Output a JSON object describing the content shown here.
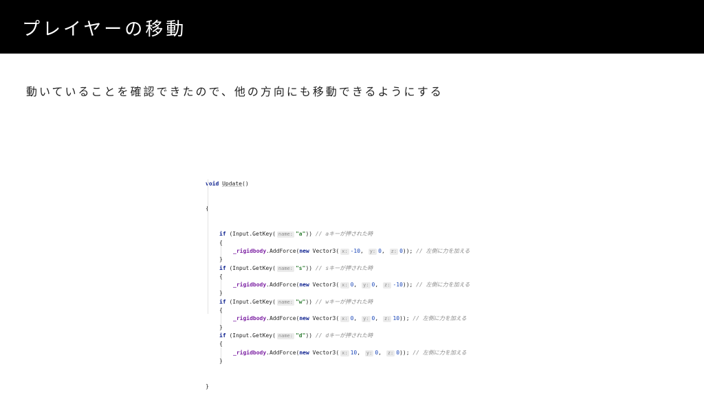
{
  "slide": {
    "title": "プレイヤーの移動",
    "description": "動いていることを確認できたので、他の方向にも移動できるようにする"
  },
  "code": {
    "void": "void",
    "method": "Update",
    "parens": "()",
    "open_brace": "{",
    "close_brace": "}",
    "if": "if",
    "input_call": "(Input.GetKey(",
    "name_hint": "name:",
    "close_call": "))",
    "comment_slash": "//",
    "field": "_rigidbody",
    "add_force": ".AddForce(",
    "new": "new",
    "vector": "Vector3(",
    "x_hint": "x:",
    "y_hint": "y:",
    "z_hint": "z:",
    "comma": ",",
    "end": "));",
    "force_comment": "左側に力を加える",
    "blocks": [
      {
        "key": "\"a\"",
        "key_comment": "aキーが押された時",
        "x": "-10",
        "y": "0",
        "z": "0"
      },
      {
        "key": "\"s\"",
        "key_comment": "sキーが押された時",
        "x": "0",
        "y": "0",
        "z": "-10"
      },
      {
        "key": "\"w\"",
        "key_comment": "wキーが押された時",
        "x": "0",
        "y": "0",
        "z": "10"
      },
      {
        "key": "\"d\"",
        "key_comment": "dキーが押された時",
        "x": "10",
        "y": "0",
        "z": "0"
      }
    ]
  }
}
